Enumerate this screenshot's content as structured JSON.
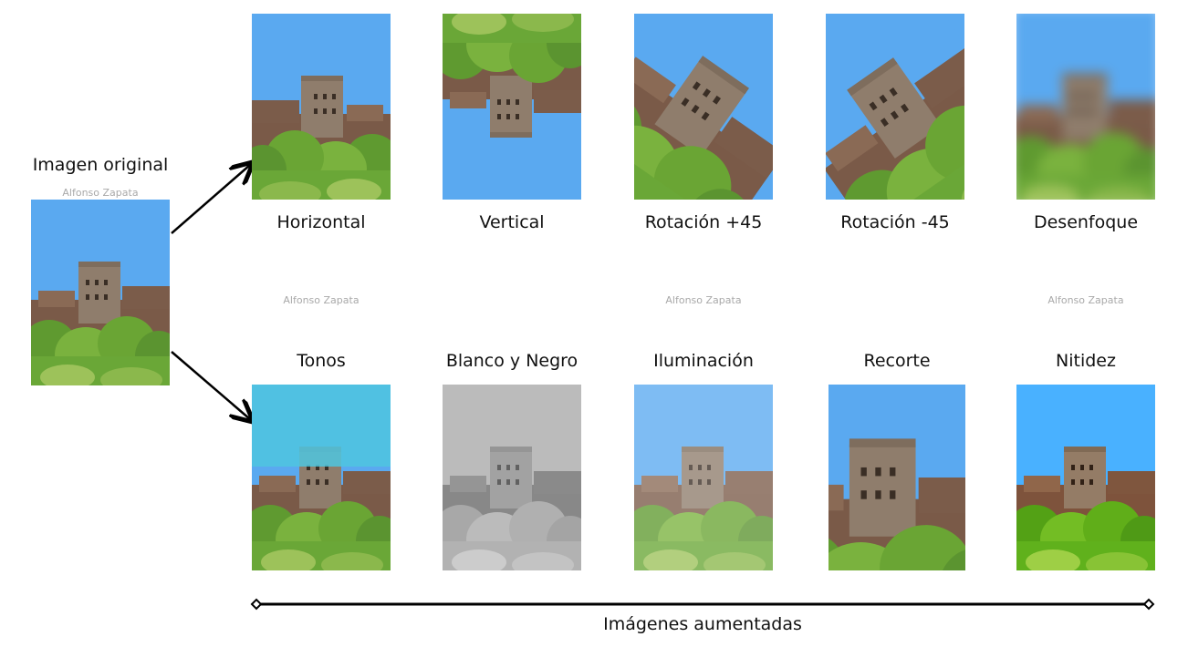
{
  "original": {
    "title": "Imagen original",
    "watermark": "Alfonso Zapata"
  },
  "top_row": [
    {
      "label": "Horizontal"
    },
    {
      "label": "Vertical"
    },
    {
      "label": "Rotación +45"
    },
    {
      "label": "Rotación -45"
    },
    {
      "label": "Desenfoque"
    }
  ],
  "bottom_row": [
    {
      "label": "Tonos"
    },
    {
      "label": "Blanco y Negro"
    },
    {
      "label": "Iluminación"
    },
    {
      "label": "Recorte"
    },
    {
      "label": "Nitidez"
    }
  ],
  "watermarks": [
    "Alfonso Zapata",
    "Alfonso Zapata",
    "Alfonso Zapata"
  ],
  "footer": {
    "label": "Imágenes aumentadas"
  },
  "colors": {
    "sky": "#5aa9f0",
    "tree": "#6fa83a",
    "tower": "#8a7a6a",
    "tone_sky": "#4fc6df"
  }
}
